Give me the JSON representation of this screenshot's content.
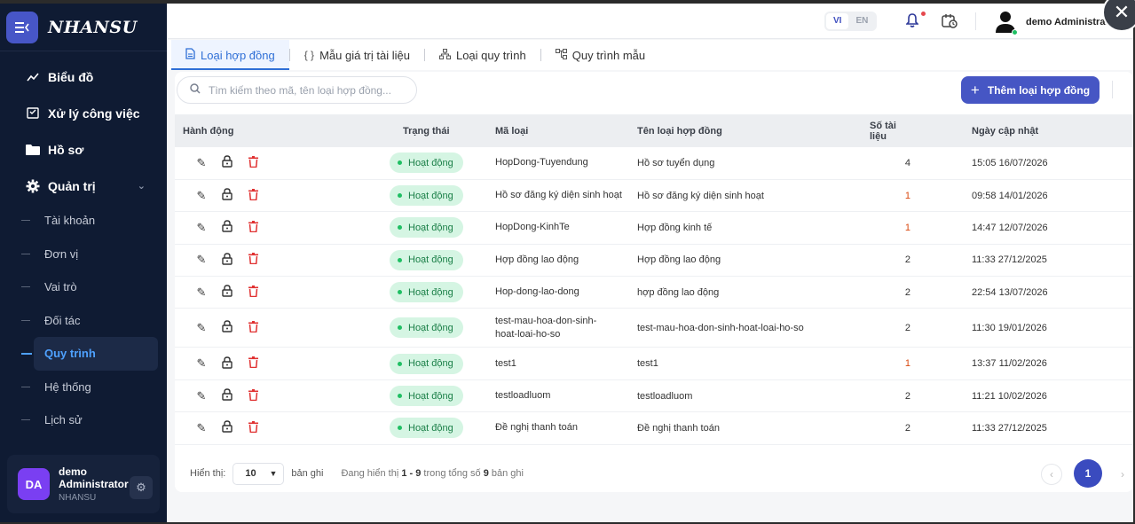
{
  "app": {
    "brand": "NHANSU"
  },
  "sidebar": {
    "items": [
      {
        "label": "Biểu đồ",
        "icon": "chart-line-icon"
      },
      {
        "label": "Xử lý công việc",
        "icon": "tasks-icon"
      },
      {
        "label": "Hồ sơ",
        "icon": "folder-icon"
      },
      {
        "label": "Quản trị",
        "icon": "gear-icon",
        "expanded": true
      }
    ],
    "subitems": [
      {
        "label": "Tài khoản"
      },
      {
        "label": "Đơn vị"
      },
      {
        "label": "Vai trò"
      },
      {
        "label": "Đối tác"
      },
      {
        "label": "Quy trình",
        "active": true
      },
      {
        "label": "Hệ thống"
      },
      {
        "label": "Lịch sử"
      }
    ],
    "user": {
      "initials": "DA",
      "name": "demo Administrator",
      "org": "NHANSU"
    }
  },
  "header": {
    "lang_vi": "VI",
    "lang_en": "EN",
    "active_lang": "VI",
    "user_name": "demo Administrato"
  },
  "tabs": [
    {
      "label": "Loại hợp đồng",
      "icon": "document-icon",
      "active": true
    },
    {
      "label": "Mẫu giá trị tài liệu",
      "icon": "braces-icon"
    },
    {
      "label": "Loại quy trình",
      "icon": "hierarchy-icon"
    },
    {
      "label": "Quy trình mẫu",
      "icon": "flow-icon"
    }
  ],
  "toolbar": {
    "search_placeholder": "Tìm kiếm theo mã, tên loại hợp đồng...",
    "add_label": "Thêm loại hợp đồng"
  },
  "table": {
    "columns": [
      "Hành động",
      "Trạng thái",
      "Mã loại",
      "Tên loại hợp đồng",
      "Số tài liệu",
      "Ngày cập nhật"
    ],
    "rows": [
      {
        "status": "Hoạt động",
        "ma": "HopDong-Tuyendung",
        "ten": "Hồ sơ tuyển dụng",
        "so": "4",
        "ngay": "15:05 16/07/2026"
      },
      {
        "status": "Hoạt động",
        "ma": "Hồ sơ đăng ký diện sinh hoạt",
        "ten": "Hồ sơ đăng ký diện sinh hoạt",
        "so": "1",
        "ngay": "09:58 14/01/2026"
      },
      {
        "status": "Hoạt động",
        "ma": "HopDong-KinhTe",
        "ten": "Hợp đồng kinh tế",
        "so": "1",
        "ngay": "14:47 12/07/2026"
      },
      {
        "status": "Hoạt động",
        "ma": "Hợp đồng lao động",
        "ten": "Hợp đồng lao động",
        "so": "2",
        "ngay": "11:33 27/12/2025"
      },
      {
        "status": "Hoạt động",
        "ma": "Hop-dong-lao-dong",
        "ten": "hợp đồng lao động",
        "so": "2",
        "ngay": "22:54 13/07/2026"
      },
      {
        "status": "Hoạt động",
        "ma": "test-mau-hoa-don-sinh-\nhoat-loai-ho-so",
        "ten": "test-mau-hoa-don-sinh-hoat-loai-ho-so",
        "so": "2",
        "ngay": "11:30 19/01/2026"
      },
      {
        "status": "Hoạt động",
        "ma": "test1",
        "ten": "test1",
        "so": "1",
        "ngay": "13:37 11/02/2026"
      },
      {
        "status": "Hoạt động",
        "ma": "testloadluom",
        "ten": "testloadluom",
        "so": "2",
        "ngay": "11:21 10/02/2026"
      },
      {
        "status": "Hoạt động",
        "ma": "Đề nghị thanh toán",
        "ten": "Đề nghị thanh toán",
        "so": "2",
        "ngay": "11:33 27/12/2025"
      }
    ]
  },
  "footer": {
    "show_label": "Hiển thị:",
    "page_size": "10",
    "records_label": "bản ghi",
    "info_prefix": "Đang hiển thị",
    "range": "1 - 9",
    "info_mid": "trong tổng số",
    "total": "9",
    "info_suffix": "bản ghi",
    "current_page": "1"
  },
  "colors": {
    "sidebar_bg": "#0f1b33",
    "accent": "#4656c4",
    "active_link": "#4ea1ff",
    "status_bg": "#d5f5e3",
    "status_text": "#1a7f47",
    "delete": "#e03131"
  }
}
